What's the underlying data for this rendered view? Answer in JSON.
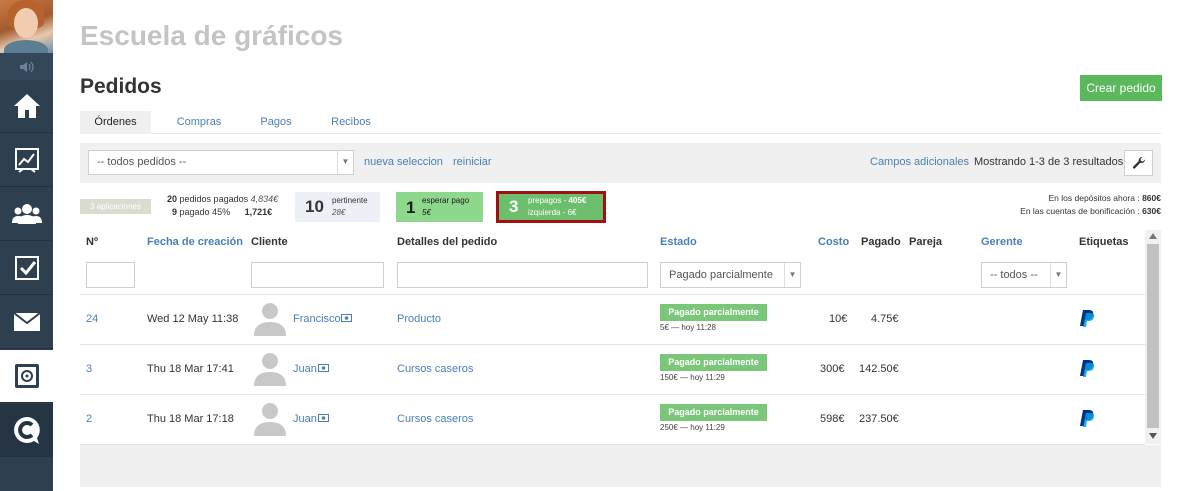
{
  "app": {
    "title": "Escuela de gráficos"
  },
  "page": {
    "title": "Pedidos",
    "create_button": "Crear pedido"
  },
  "tabs": [
    {
      "label": "Órdenes",
      "active": true
    },
    {
      "label": "Compras",
      "active": false
    },
    {
      "label": "Pagos",
      "active": false
    },
    {
      "label": "Recibos",
      "active": false
    }
  ],
  "filter": {
    "select_value": "-- todos pedidos --",
    "new_selection": "nueva seleccion",
    "reset": "reiniciar",
    "extra_fields": "Campos adicionales",
    "results": "Mostrando 1-3 de 3 resultados."
  },
  "stats": {
    "apps_badge": "3 aplicaciones",
    "paid_count": "20",
    "paid_label": "pedidos pagados",
    "paid_amount": "4,834€",
    "paid45_count": "9",
    "paid45_label": "pagado 45%",
    "paid45_amount": "1,721€",
    "pertinent_count": "10",
    "pertinent_label": "pertinente",
    "pertinent_amount": "28€",
    "waiting_count": "1",
    "waiting_label": "esperar pago",
    "waiting_amount": "5€",
    "prepaid_count": "3",
    "prepaid_label": "prepagos - ",
    "prepaid_amount": "405€",
    "left_label": "izquierda - 6€",
    "deposits_label": "En los depósitos ahora : ",
    "deposits_value": "860€",
    "bonus_label": "En las cuentas de bonificación : ",
    "bonus_value": "630€"
  },
  "table": {
    "headers": {
      "num": "Nº",
      "created": "Fecha de creación",
      "client": "Cliente",
      "details": "Detalles del pedido",
      "status": "Estado",
      "cost": "Costo",
      "paid": "Pagado",
      "pair": "Pareja",
      "manager": "Gerente",
      "tags": "Etiquetas"
    },
    "status_filter": "Pagado parcialmente",
    "manager_filter": "-- todos --",
    "rows": [
      {
        "num": "24",
        "date": "Wed 12 May 11:38",
        "client": "Francisco",
        "details": "Producto",
        "status": "Pagado parcialmente",
        "status_sub": "5€ — hoy 11:28",
        "cost": "10€",
        "paid": "4.75€"
      },
      {
        "num": "3",
        "date": "Thu 18 Mar 17:41",
        "client": "Juan",
        "details": "Cursos caseros",
        "status": "Pagado parcialmente",
        "status_sub": "150€ — hoy 11:29",
        "cost": "300€",
        "paid": "142.50€"
      },
      {
        "num": "2",
        "date": "Thu 18 Mar 17:18",
        "client": "Juan",
        "details": "Cursos caseros",
        "status": "Pagado parcialmente",
        "status_sub": "250€ — hoy 11:29",
        "cost": "598€",
        "paid": "237.50€"
      }
    ]
  },
  "colors": {
    "sidebar": "#2e3f4f",
    "accent_green": "#5cb85c",
    "link_blue": "#4a7fb5",
    "highlight_red": "#a01010",
    "paypal_dark": "#003087",
    "paypal_light": "#009cde"
  },
  "icons": {
    "sidebar": [
      "home-icon",
      "chart-icon",
      "users-icon",
      "checkbox-icon",
      "mail-icon",
      "safe-icon",
      "chat-logo-icon"
    ],
    "wrench": "wrench-icon",
    "money": "money-icon",
    "paypal": "paypal-icon"
  }
}
